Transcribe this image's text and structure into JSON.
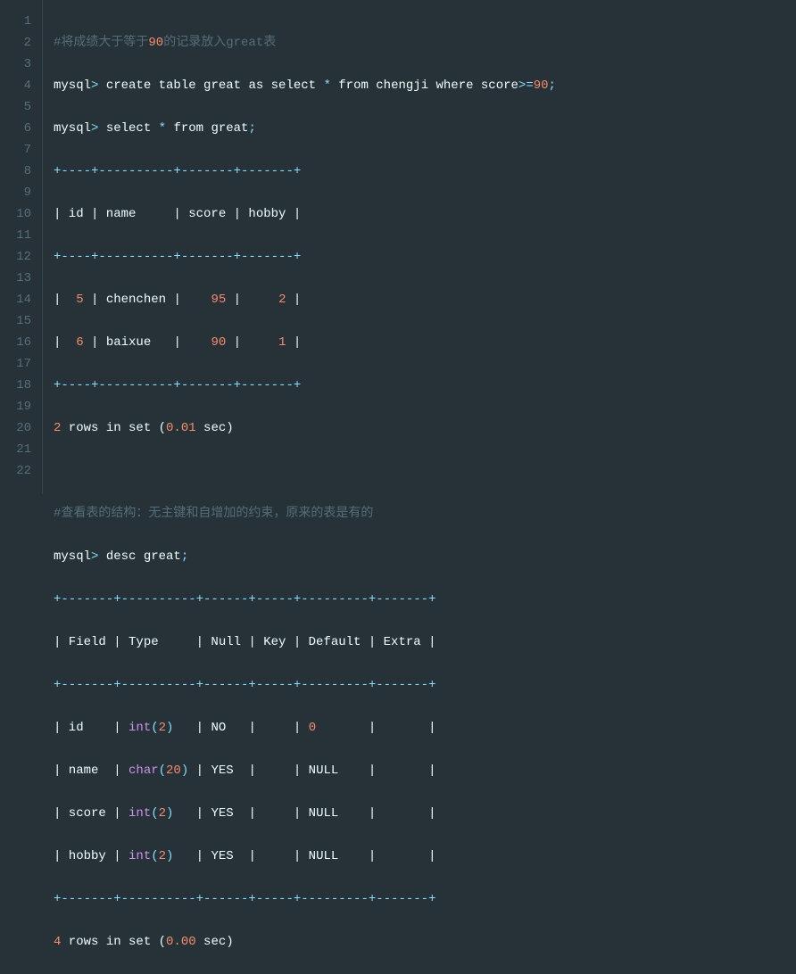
{
  "lines": {
    "l1_comment": "#将成绩大于等于",
    "l1_num": "90",
    "l1_comment2": "的记录放入great表",
    "l2_mysql": "mysql",
    "l2_gt": ">",
    "l2_rest1": " create table great as select ",
    "l2_star": "*",
    "l2_rest2": " from chengji where score",
    "l2_ge": ">=",
    "l2_num": "90",
    "l2_semi": ";",
    "l3_mysql": "mysql",
    "l3_gt": ">",
    "l3_rest1": " select ",
    "l3_star": "*",
    "l3_rest2": " from great",
    "l3_semi": ";",
    "l4_border": "+----+----------+-------+-------+",
    "l5_header": "| id | name     | score | hobby |",
    "l6_border": "+----+----------+-------+-------+",
    "l7_p1": "|  ",
    "l7_n1": "5",
    "l7_p2": " | chenchen |    ",
    "l7_n2": "95",
    "l7_p3": " |     ",
    "l7_n3": "2",
    "l7_p4": " |",
    "l8_p1": "|  ",
    "l8_n1": "6",
    "l8_p2": " | baixue   |    ",
    "l8_n2": "90",
    "l8_p3": " |     ",
    "l8_n3": "1",
    "l8_p4": " |",
    "l9_border": "+----+----------+-------+-------+",
    "l10_n1": "2",
    "l10_t1": " rows in set (",
    "l10_n2": "0.01",
    "l10_t2": " sec)",
    "l12_comment": "#查看表的结构：无主键和自增加的约束，原来的表是有的",
    "l13_mysql": "mysql",
    "l13_gt": ">",
    "l13_rest": " desc great",
    "l13_semi": ";",
    "l14_border": "+-------+----------+------+-----+---------+-------+",
    "l15_header": "| Field | Type     | Null | Key | Default | Extra |",
    "l16_border": "+-------+----------+------+-----+---------+-------+",
    "l17_p1": "| id    | ",
    "l17_kw": "int",
    "l17_po": "(",
    "l17_n": "2",
    "l17_pc": ")",
    "l17_p2": "   | NO   |     | ",
    "l17_n2": "0",
    "l17_p3": "       |       |",
    "l18_p1": "| name  | ",
    "l18_kw": "char",
    "l18_po": "(",
    "l18_n": "20",
    "l18_pc": ")",
    "l18_p2": " | YES  |     | NULL    |       |",
    "l19_p1": "| score | ",
    "l19_kw": "int",
    "l19_po": "(",
    "l19_n": "2",
    "l19_pc": ")",
    "l19_p2": "   | YES  |     | NULL    |       |",
    "l20_p1": "| hobby | ",
    "l20_kw": "int",
    "l20_po": "(",
    "l20_n": "2",
    "l20_pc": ")",
    "l20_p2": "   | YES  |     | NULL    |       |",
    "l21_border": "+-------+----------+------+-----+---------+-------+",
    "l22_n1": "4",
    "l22_t1": " rows in set (",
    "l22_n2": "0.00",
    "l22_t2": " sec)"
  },
  "linenums": [
    "1",
    "2",
    "3",
    "4",
    "5",
    "6",
    "7",
    "8",
    "9",
    "10",
    "11",
    "12",
    "13",
    "14",
    "15",
    "16",
    "17",
    "18",
    "19",
    "20",
    "21",
    "22"
  ]
}
